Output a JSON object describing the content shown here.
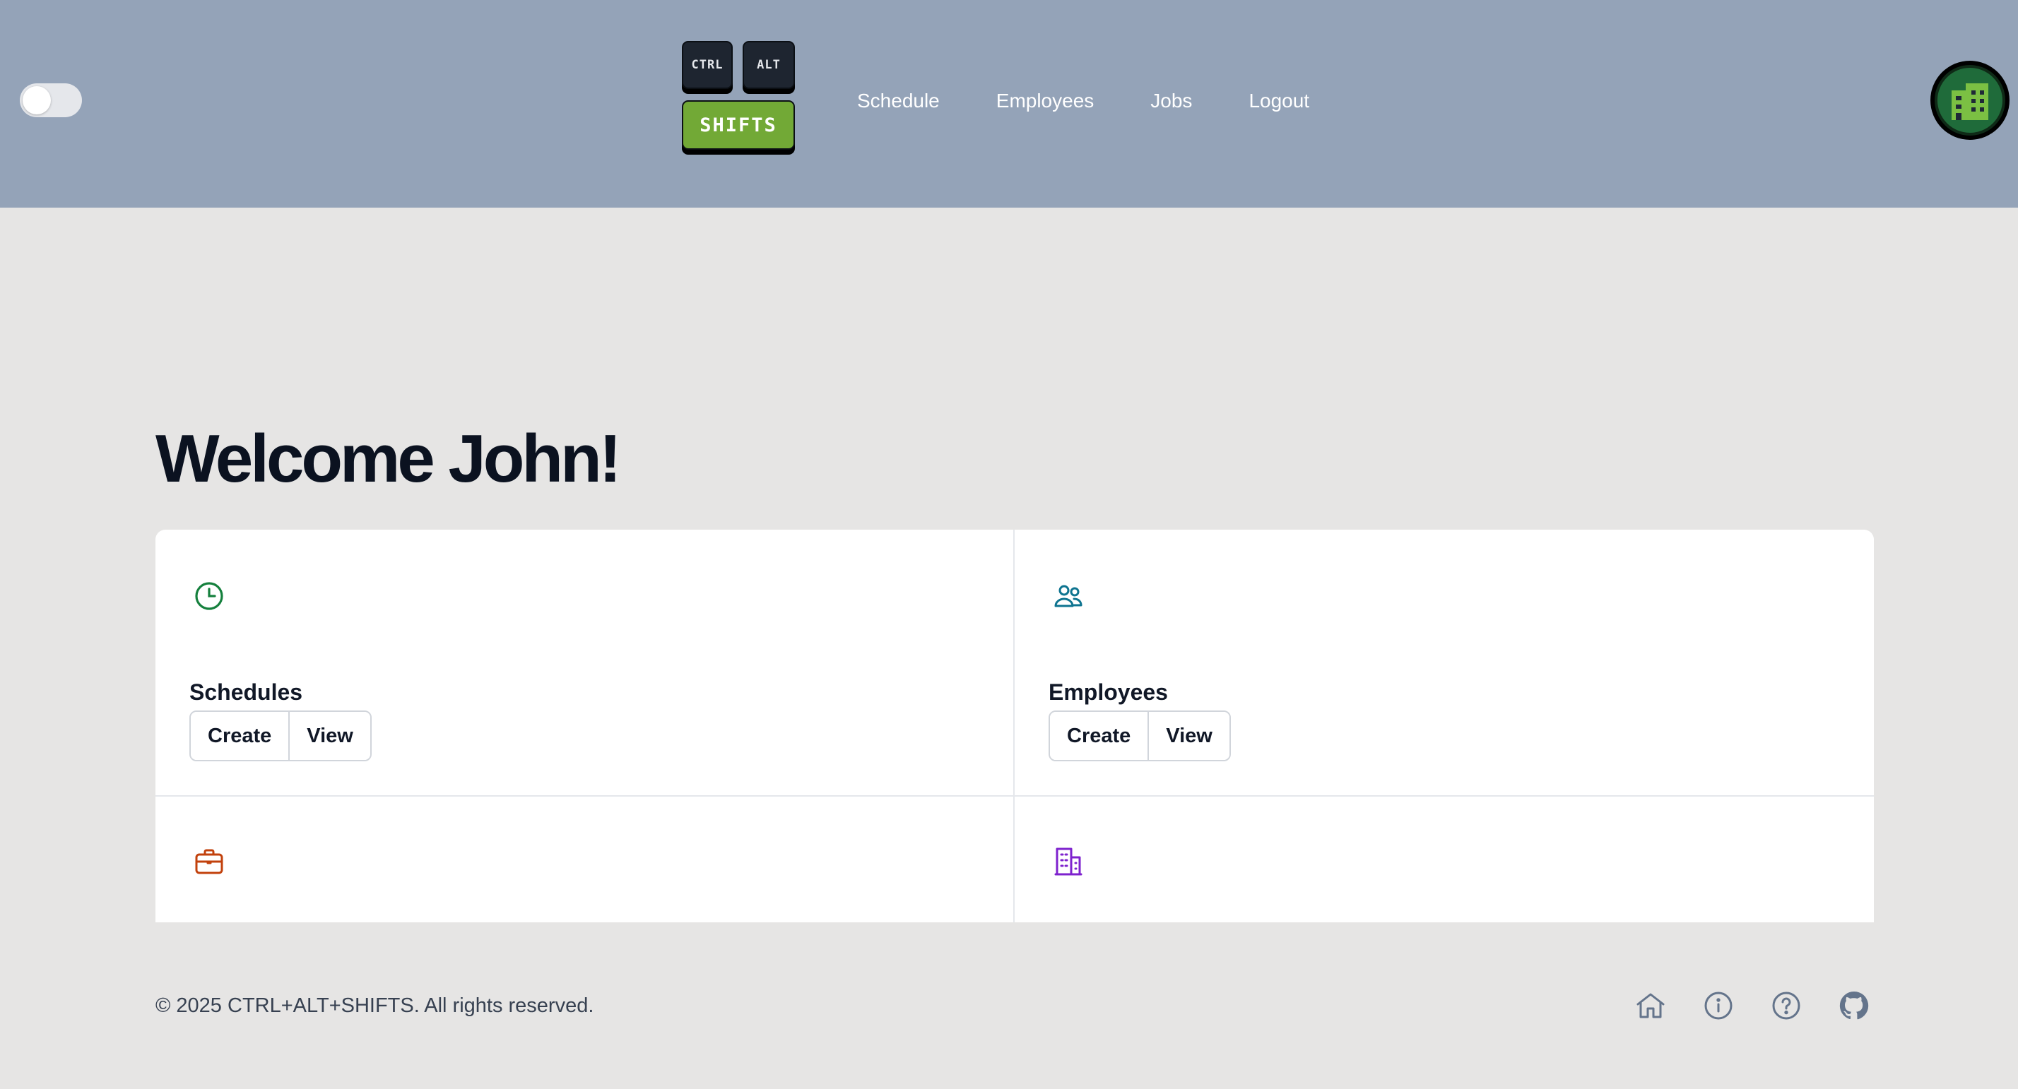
{
  "header": {
    "logo": {
      "key1": "CTRL",
      "key2": "ALT",
      "key3": "SHIFTS"
    },
    "nav": [
      "Schedule",
      "Employees",
      "Jobs",
      "Logout"
    ],
    "toggle_state": "off"
  },
  "main": {
    "welcome": "Welcome John!",
    "cards": [
      {
        "title": "Schedules",
        "icon": "clock-icon",
        "icon_color": "#15803d",
        "buttons": [
          "Create",
          "View"
        ]
      },
      {
        "title": "Employees",
        "icon": "users-icon",
        "icon_color": "#0e7490",
        "buttons": [
          "Create",
          "View"
        ]
      },
      {
        "title": "",
        "icon": "briefcase-icon",
        "icon_color": "#c2410c",
        "buttons": []
      },
      {
        "title": "",
        "icon": "building-icon",
        "icon_color": "#7e22ce",
        "buttons": []
      }
    ]
  },
  "footer": {
    "copyright": "© 2025 CTRL+ALT+SHIFTS. All rights reserved.",
    "icons": [
      "home-icon",
      "info-icon",
      "help-icon",
      "github-icon"
    ]
  },
  "colors": {
    "header_bg": "#94a3b8",
    "page_bg": "#e6e5e4",
    "logo_green": "#72a936",
    "footer_icon": "#64748b"
  }
}
